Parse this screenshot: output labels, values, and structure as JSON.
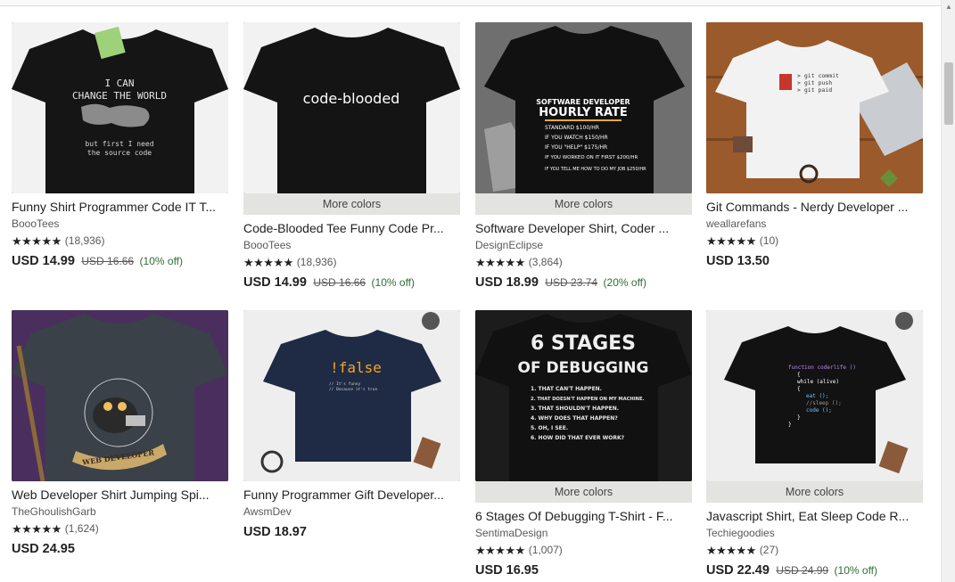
{
  "products": [
    {
      "title": "Funny Shirt Programmer Code IT T...",
      "shop": "BoooTees",
      "reviews": "(18,936)",
      "price": "USD 14.99",
      "original_price": "USD 16.66",
      "discount": "(10% off)",
      "more_colors": "",
      "image": {
        "shirt": "#151515",
        "bg": "#f2f2f2",
        "lines": [
          "I CAN",
          "CHANGE THE WORLD",
          "but first I need",
          "the source code"
        ]
      }
    },
    {
      "title": "Code-Blooded Tee Funny Code Pr...",
      "shop": "BoooTees",
      "reviews": "(18,936)",
      "price": "USD 14.99",
      "original_price": "USD 16.66",
      "discount": "(10% off)",
      "more_colors": "More colors",
      "image": {
        "shirt": "#141414",
        "bg": "#f2f2f2",
        "lines": [
          "code-blooded"
        ]
      }
    },
    {
      "title": "Software Developer Shirt, Coder ...",
      "shop": "DesignEclipse",
      "reviews": "(3,864)",
      "price": "USD 18.99",
      "original_price": "USD 23.74",
      "discount": "(20% off)",
      "more_colors": "More colors",
      "image": {
        "shirt": "#111111",
        "bg": "#6f6f6f",
        "lines": [
          "SOFTWARE DEVELOPER",
          "HOURLY RATE",
          "STANDARD   $100/HR",
          "IF YOU WATCH   $150/HR",
          "IF YOU \"HELP\"   $175/HR",
          "IF YOU WORKED ON IT FIRST   $200/HR",
          "IF YOU TELL ME HOW TO DO MY JOB   $250/HR"
        ]
      }
    },
    {
      "title": "Git Commands - Nerdy Developer ...",
      "shop": "weallarefans",
      "reviews": "(10)",
      "price": "USD 13.50",
      "original_price": "",
      "discount": "",
      "more_colors": "",
      "image": {
        "shirt": "#f2f2f2",
        "bg": "#9a5a2c",
        "lines": [
          "> git commit",
          "> git push",
          "> git paid"
        ]
      }
    },
    {
      "title": "Web Developer Shirt Jumping Spi...",
      "shop": "TheGhoulishGarb",
      "reviews": "(1,624)",
      "price": "USD 24.95",
      "original_price": "",
      "discount": "",
      "more_colors": "",
      "image": {
        "shirt": "#3a4148",
        "bg": "#4a2f5e",
        "lines": [
          "WEB DEVELOPER"
        ]
      }
    },
    {
      "title": "Funny Programmer Gift Developer...",
      "shop": "AwsmDev",
      "reviews": "",
      "price": "USD 18.97",
      "original_price": "",
      "discount": "",
      "more_colors": "",
      "image": {
        "shirt": "#1f2b45",
        "bg": "#eeeeee",
        "lines": [
          "!false",
          "// It's funny",
          "// Because it's true"
        ]
      }
    },
    {
      "title": "6 Stages Of Debugging T-Shirt - F...",
      "shop": "SentimaDesign",
      "reviews": "(1,007)",
      "price": "USD 16.95",
      "original_price": "",
      "discount": "",
      "more_colors": "More colors",
      "image": {
        "shirt": "#111111",
        "bg": "#1c1c1c",
        "lines": [
          "6 STAGES",
          "OF DEBUGGING",
          "1. THAT CAN'T HAPPEN.",
          "2. THAT DOESN'T HAPPEN ON MY MACHINE.",
          "3. THAT SHOULDN'T HAPPEN.",
          "4. WHY DOES THAT HAPPEN?",
          "5. OH, I SEE.",
          "6. HOW DID THAT EVER WORK?"
        ]
      }
    },
    {
      "title": "Javascript Shirt, Eat Sleep Code R...",
      "shop": "Techiegoodies",
      "reviews": "(27)",
      "price": "USD 22.49",
      "original_price": "USD 24.99",
      "discount": "(10% off)",
      "more_colors": "More colors",
      "image": {
        "shirt": "#121212",
        "bg": "#eeeeee",
        "lines": [
          "function coderlife ()",
          "{",
          "while (alive)",
          "{",
          "eat ();",
          "//sleep ();",
          "code ();",
          "}",
          "}"
        ]
      }
    }
  ],
  "stars": "★★★★★",
  "colors": {
    "discount_green": "#2f6e37",
    "more_colors_bg": "#e3e3e0"
  }
}
